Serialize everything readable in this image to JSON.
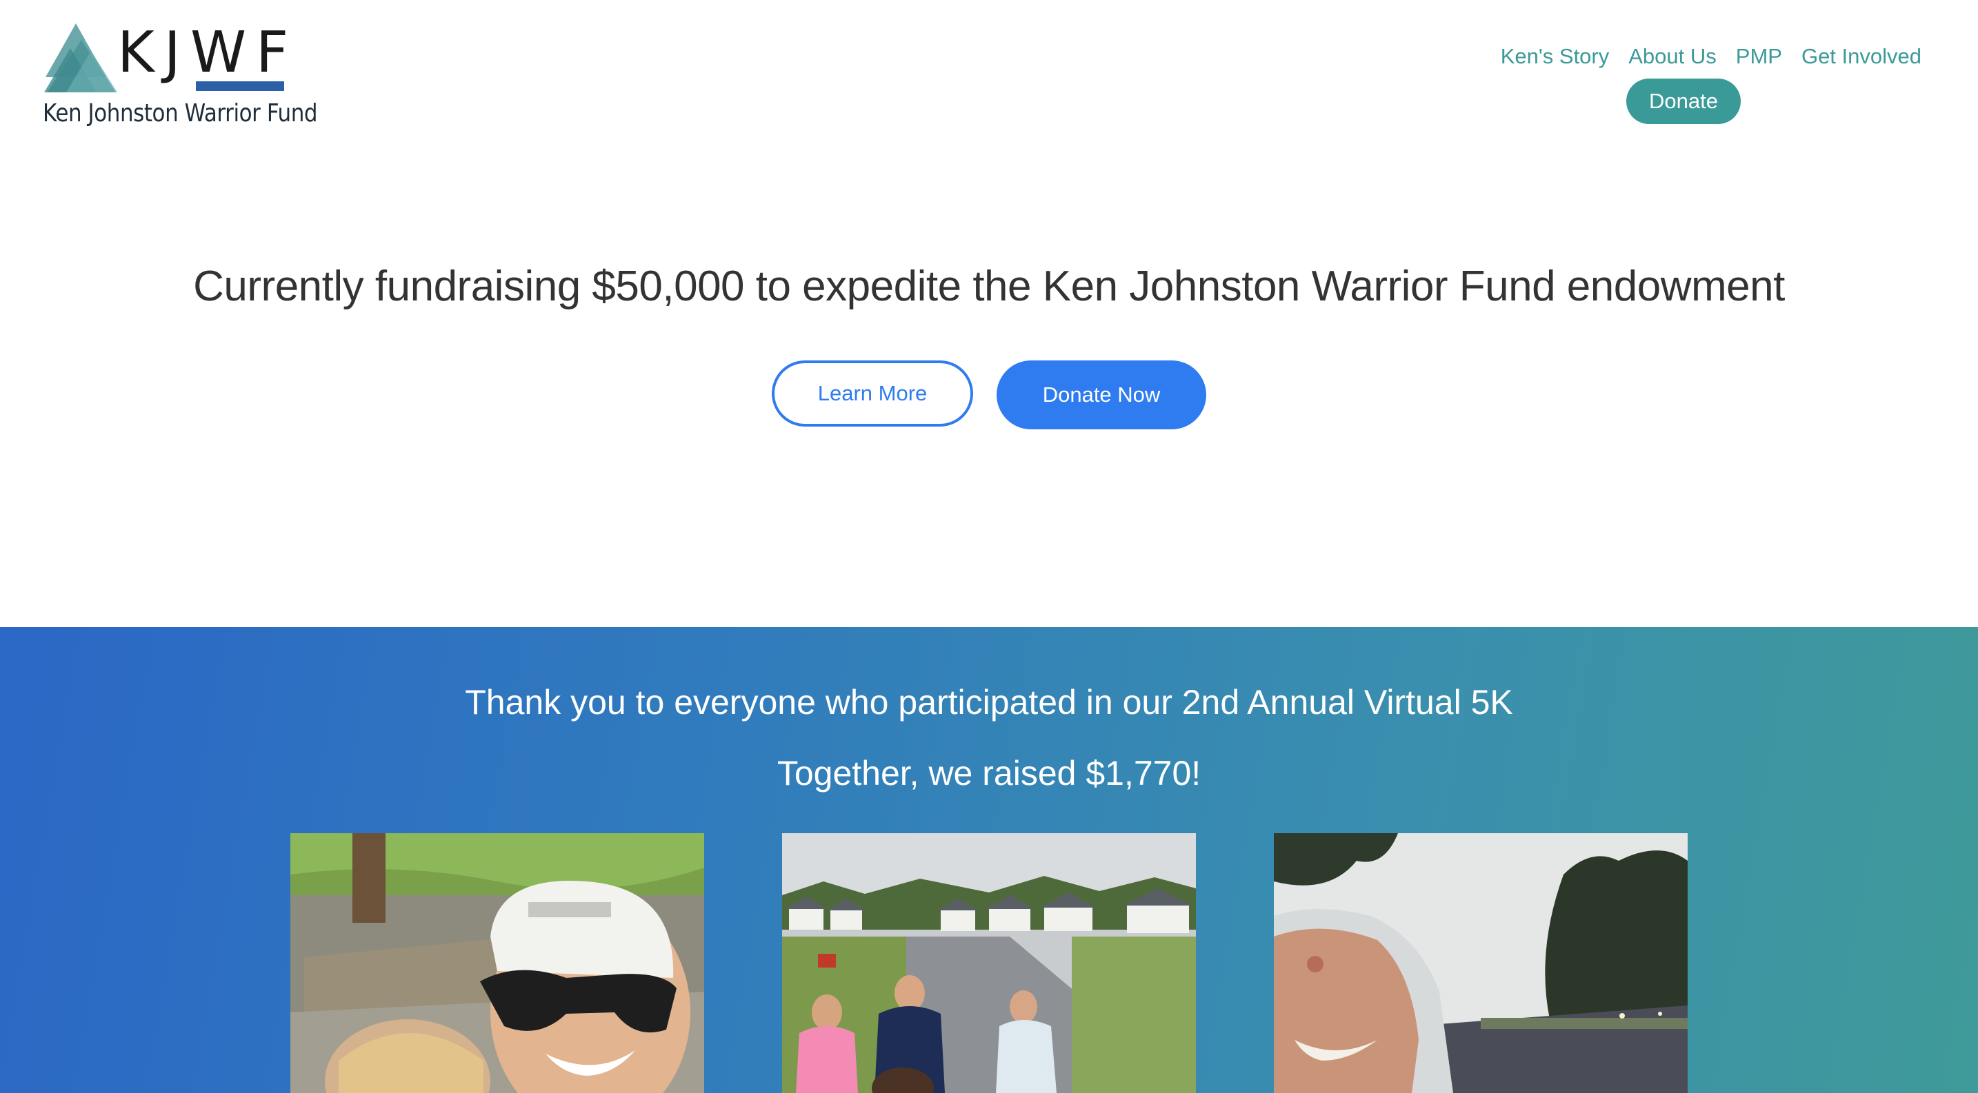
{
  "logo": {
    "letters": "KJWF",
    "name": "Ken Johnston Warrior Fund"
  },
  "nav": {
    "links": [
      "Ken's Story",
      "About Us",
      "PMP",
      "Get Involved"
    ],
    "donate_label": "Donate"
  },
  "hero": {
    "title": "Currently fundraising $50,000 to expedite the Ken Johnston Warrior Fund endowment",
    "learn_more_label": "Learn More",
    "donate_now_label": "Donate Now"
  },
  "thanks": {
    "line1": "Thank you to everyone who participated in our 2nd Annual Virtual 5K",
    "line2": "Together, we raised $1,770!"
  },
  "colors": {
    "teal": "#3a9a98",
    "blue_button": "#2f7bf0",
    "logo_bar": "#2c5fa8",
    "gradient_start": "#2b67c6",
    "gradient_end": "#3f9a99"
  }
}
